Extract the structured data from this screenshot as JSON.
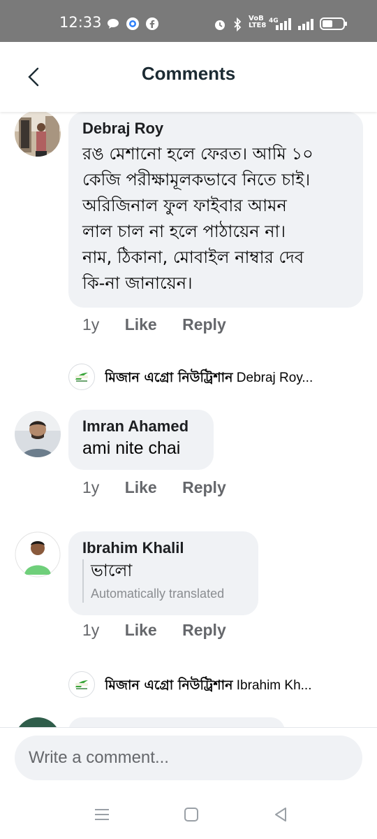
{
  "status_bar": {
    "time": "12:33",
    "network": "4G"
  },
  "header": {
    "title": "Comments"
  },
  "comments": [
    {
      "author": "Debraj Roy",
      "text_lines": [
        "রঙ মেশানো হলে ফেরত। আমি ১০",
        "কেজি পরীক্ষামূলকভাবে নিতে চাই।",
        "অরিজিনাল ফুল ফাইবার আমন",
        "লাল চাল না হলে পাঠায়েন না।",
        "নাম, ঠিকানা, মোবাইল নাম্বার দেব",
        "কি-না জানায়েন।"
      ],
      "time": "1y",
      "like": "Like",
      "reply": "Reply"
    },
    {
      "author": "Imran Ahamed",
      "text": "ami nite chai",
      "time": "1y",
      "like": "Like",
      "reply": "Reply"
    },
    {
      "author": "Ibrahim Khalil",
      "text": "ভালো",
      "translation_note": "Automatically translated",
      "time": "1y",
      "like": "Like",
      "reply": "Reply"
    }
  ],
  "replies": [
    {
      "page_name": "মিজান এগ্রো নিউট্রিশান",
      "preview": "Debraj Roy..."
    },
    {
      "page_name": "মিজান এগ্রো নিউট্রিশান",
      "preview": "Ibrahim Kh..."
    }
  ],
  "composer": {
    "placeholder": "Write a comment..."
  },
  "colors": {
    "bubble": "#f0f2f5",
    "muted": "#65676b",
    "title": "#1c2b33"
  }
}
